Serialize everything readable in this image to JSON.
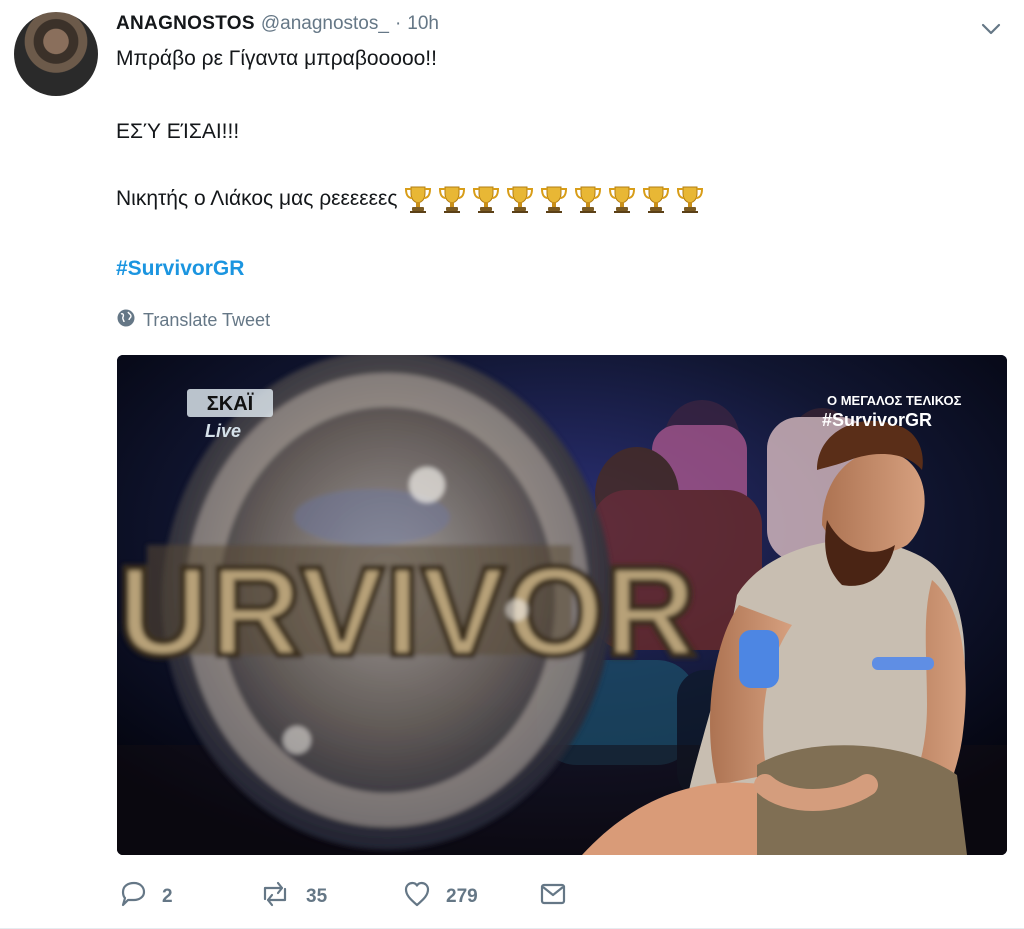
{
  "tweet": {
    "author": {
      "name": "ANAGNOSTOS",
      "handle": "@anagnostos_",
      "separator": "·",
      "time": "10h"
    },
    "lines": [
      "Μπράβο ρε Γίγαντα μπραβοοοοο!!",
      "ΕΣΎ ΕΊΣΑΙ!!!",
      "Νικητής ο Λιάκος μας ρεεεεεες"
    ],
    "trophy_count": 9,
    "hashtag": "#SurvivorGR",
    "translate_label": "Translate Tweet"
  },
  "media": {
    "channel_logo": "ΣΚΑΪ",
    "live_label": "Live",
    "overlay_title": "Ο ΜΕΓΑΛΟΣ ΤΕΛΙΚΟΣ",
    "overlay_hashtag": "#SurvivorGR",
    "trophy_text": "SURVIVOR"
  },
  "actions": {
    "replies": "2",
    "retweets": "35",
    "likes": "279"
  },
  "colors": {
    "text": "#14171a",
    "muted": "#657786",
    "accent": "#1b95e0",
    "trophy_gold": "#e8b735"
  },
  "icons": [
    "chevron-down-icon",
    "globe-icon",
    "reply-icon",
    "retweet-icon",
    "heart-icon",
    "mail-icon",
    "trophy-icon"
  ]
}
